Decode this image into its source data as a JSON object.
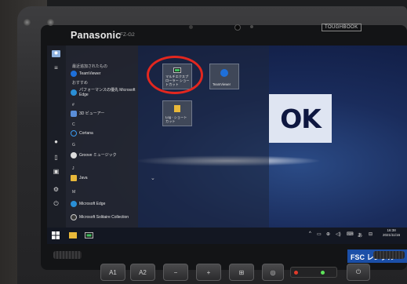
{
  "device": {
    "brand": "Panasonic",
    "model": "FZ-G2",
    "badge": "TOUGHBOOK"
  },
  "desktop": {
    "logo_text": "OK"
  },
  "start_menu": {
    "recent_header": "最近追加されたもの",
    "recent_item": "TeamViewer",
    "recommended_header": "おすすめ",
    "recommended_item": "パフォーマンスの優先 Microsoft Edge",
    "group_hash": "#",
    "item_3d": "3D ビューアー",
    "group_c": "C",
    "item_cortana": "Cortana",
    "group_g": "G",
    "item_groove": "Groove ミュージック",
    "group_j": "J",
    "item_java": "Java",
    "group_m": "M",
    "item_edge": "Microsoft Edge",
    "item_solitaire": "Microsoft Solitaire Collection"
  },
  "tiles": {
    "multiexplorer": "マルチエクスプローラー ショートカット",
    "teamviewer": "TeamViewer",
    "log_shortcut": "Log - ショートカット"
  },
  "taskbar": {
    "tray_ime": "あ",
    "time": "16:38",
    "date": "2021/11/16"
  },
  "sticker": {
    "text": "FSC レンタル"
  },
  "hardware_buttons": {
    "a1": "A1",
    "a2": "A2",
    "minus": "−",
    "plus": "+",
    "windows": "⊞",
    "camera": "◎",
    "power": "⏻"
  },
  "colors": {
    "annotation_circle": "#e2271f",
    "sticker_blue": "#1b4fa8",
    "teamviewer_blue": "#1e6fd9",
    "desktop_blue": "#1a2c5c"
  }
}
